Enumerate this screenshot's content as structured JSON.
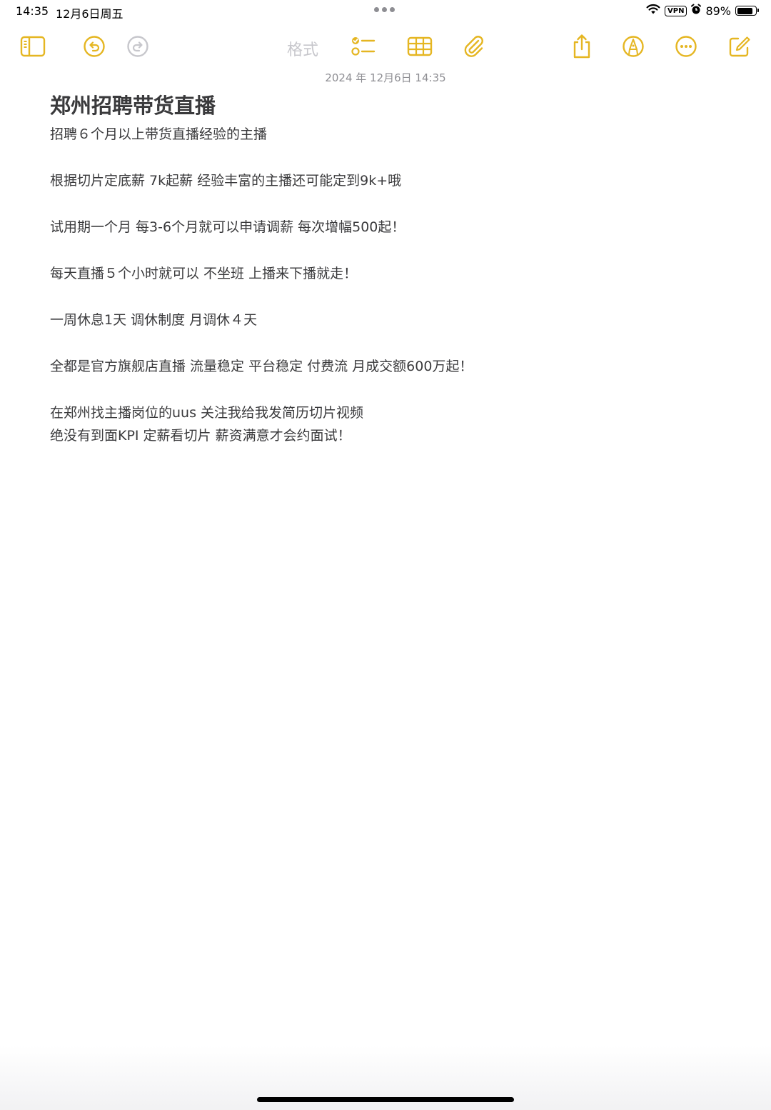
{
  "status_bar": {
    "time": "14:35",
    "date": "12月6日周五",
    "vpn": "VPN",
    "battery": "89%",
    "battery_level": 0.89,
    "icons": [
      "wifi-icon",
      "alarm-icon",
      "battery-icon"
    ]
  },
  "toolbar": {
    "format_label": "格式",
    "accent_color": "#E5B622",
    "buttons": [
      "sidebar-icon",
      "undo-icon",
      "redo-icon",
      "checklist-icon",
      "table-icon",
      "attachment-icon",
      "share-icon",
      "markup-icon",
      "more-icon",
      "compose-icon"
    ]
  },
  "note": {
    "date": "2024 年 12月6日 14:35",
    "title": "郑州招聘带货直播",
    "lines": [
      "招聘６个月以上带货直播经验的主播",
      "根据切片定底薪 7k起薪 经验丰富的主播还可能定到9k+哦",
      "试用期一个月 每3-6个月就可以申请调薪 每次增幅500起！",
      "每天直播５个小时就可以 不坐班 上播来下播就走！",
      "一周休息1天 调休制度 月调休４天",
      "全都是官方旗舰店直播 流量稳定 平台稳定 付费流 月成交额600万起！",
      "在郑州找主播岗位的uus 关注我给我发简历切片视频",
      "绝没有到面KPI 定薪看切片 薪资满意才会约面试！"
    ]
  }
}
